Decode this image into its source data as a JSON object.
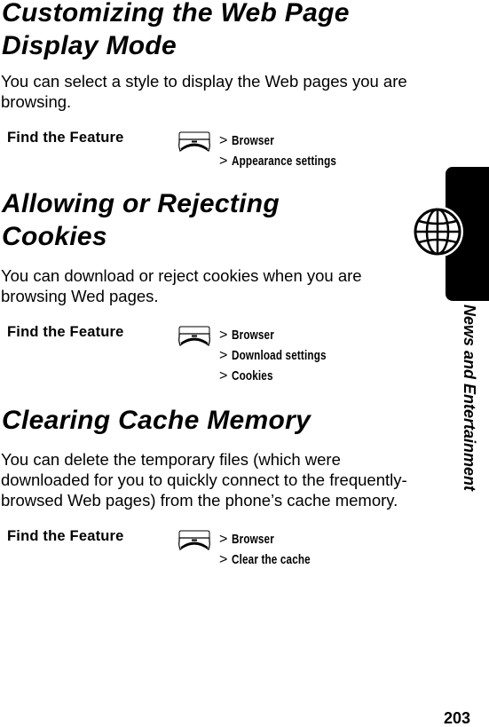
{
  "sections": [
    {
      "heading_lines": [
        "Customizing the Web Page",
        "Display Mode"
      ],
      "body_lines": [
        "You can select a style to display the Web pages you are",
        "browsing."
      ],
      "find_feature": {
        "label": "Find the Feature",
        "key_icon": "menu-key-icon",
        "path": [
          "Browser",
          "Appearance settings"
        ]
      }
    },
    {
      "heading_lines": [
        "Allowing or Rejecting",
        "Cookies"
      ],
      "body_lines": [
        "You can download or reject cookies when you are",
        "browsing Wed pages."
      ],
      "find_feature": {
        "label": "Find the Feature",
        "key_icon": "menu-key-icon",
        "path": [
          "Browser",
          "Download settings",
          "Cookies"
        ]
      }
    },
    {
      "heading_lines": [
        "Clearing Cache Memory"
      ],
      "body_lines": [
        "You can delete the temporary files (which were",
        "downloaded for you to quickly connect to the frequently-",
        "browsed Web pages) from the phone’s cache memory."
      ],
      "find_feature": {
        "label": "Find the Feature",
        "key_icon": "menu-key-icon",
        "path": [
          "Browser",
          "Clear the cache"
        ]
      }
    }
  ],
  "path_separator": ">",
  "side_tab": {
    "icon": "globe-icon",
    "label": "News and Entertainment"
  },
  "page_number": "203"
}
